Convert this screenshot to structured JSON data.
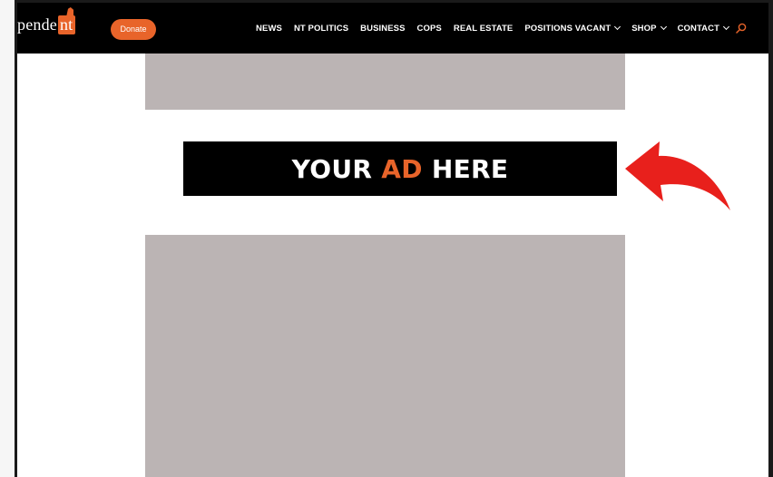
{
  "header": {
    "logo_text": "pende",
    "logo_accent": "nt",
    "donate_label": "Donate"
  },
  "nav": {
    "items": [
      {
        "label": "NEWS",
        "dropdown": false
      },
      {
        "label": "NT POLITICS",
        "dropdown": false
      },
      {
        "label": "BUSINESS",
        "dropdown": false
      },
      {
        "label": "COPS",
        "dropdown": false
      },
      {
        "label": "REAL ESTATE",
        "dropdown": false
      },
      {
        "label": "POSITIONS VACANT",
        "dropdown": true
      },
      {
        "label": "SHOP",
        "dropdown": true
      },
      {
        "label": "CONTACT",
        "dropdown": true
      }
    ],
    "search_icon": "search-icon"
  },
  "ad": {
    "text_before": "YOUR ",
    "text_accent": "AD",
    "text_after": " HERE"
  },
  "colors": {
    "accent": "#e8642a",
    "header_bg": "#000000",
    "placeholder_gray": "#bbb4b4",
    "arrow": "#e8201c"
  }
}
